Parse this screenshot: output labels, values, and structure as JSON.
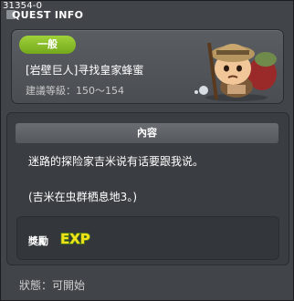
{
  "window": {
    "quest_id": "31354-0",
    "title": "QUEST INFO"
  },
  "quest": {
    "category": "一般",
    "name": "[岩壁巨人]寻找皇家蜂蜜",
    "level_range": "建議等級：150～154"
  },
  "content": {
    "header": "內容",
    "line1": "迷路的探险家吉米说有话要跟我说。",
    "line2": "(吉米在虫群栖息地3。)"
  },
  "reward": {
    "label": "獎勵",
    "exp_text": "EXP"
  },
  "status": {
    "text": "狀態：可開始"
  },
  "colors": {
    "badge_green": "#8cc42a",
    "panel_bg": "#41454a",
    "exp_yellow": "#f2e21a"
  }
}
